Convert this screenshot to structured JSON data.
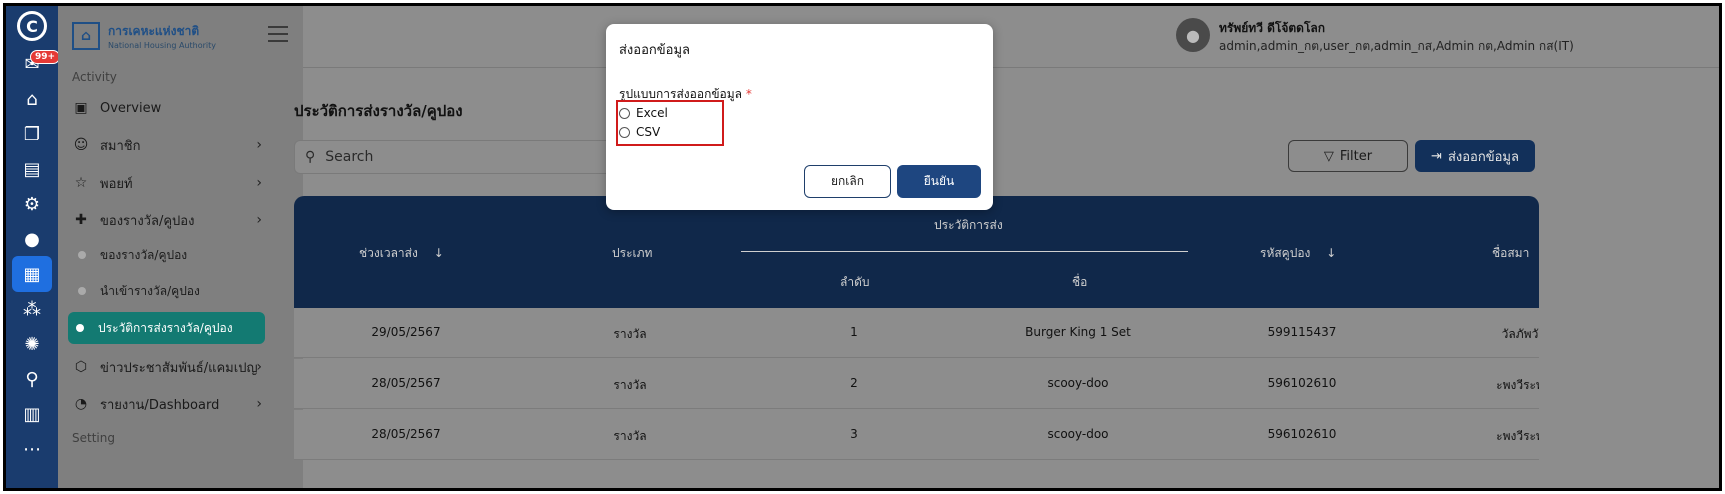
{
  "rail": {
    "badge_count": "99+",
    "icons": [
      "logo-icon",
      "inbox-icon",
      "home-icon",
      "copy-icon",
      "document-icon",
      "settings-gear-icon",
      "user-icon",
      "dashboard-grid-icon",
      "group-icon",
      "settings-cog-icon",
      "search-icon",
      "bar-chart-icon",
      "more-icon"
    ]
  },
  "brand": {
    "name_th": "การเคหะแห่งชาติ",
    "name_en": "National Housing Authority"
  },
  "sidebar": {
    "section_activity": "Activity",
    "section_setting": "Setting",
    "items": {
      "overview": "Overview",
      "member": "สมาชิก",
      "point": "พอยท์",
      "reward": "ของรางวัล/คูปอง",
      "reward_sub": "ของรางวัล/คูปอง",
      "import_sub": "นำเข้ารางวัล/คูปอง",
      "history_sub": "ประวัติการส่งรางวัล/คูปอง",
      "news": "ข่าวประชาสัมพันธ์/แคมเปญ",
      "report": "รายงาน/Dashboard"
    }
  },
  "user": {
    "name": "ทรัพย์ทวี ดีโจ้ตดโลก",
    "roles": "admin,admin_กต,user_กต,admin_กส,Admin กต,Admin กส(IT)"
  },
  "page": {
    "title": "ประวัติการส่งรางวัล/คูปอง",
    "search_placeholder": "Search",
    "filter_label": "Filter",
    "export_label": "ส่งออกข้อมูล"
  },
  "table": {
    "headers": {
      "period": "ช่วงเวลาส่ง",
      "type": "ประเภท",
      "history_group": "ประวัติการส่ง",
      "order": "ลำดับ",
      "name": "ชื่อ",
      "coupon_code": "รหัสคูปอง",
      "member_name": "ชื่อสมา"
    },
    "rows": [
      {
        "period": "29/05/2567",
        "type": "รางวัล",
        "order": "1",
        "name": "Burger King 1 Set",
        "code": "599115437",
        "member": "วัลภัพวั"
      },
      {
        "period": "28/05/2567",
        "type": "รางวัล",
        "order": "2",
        "name": "scooy-doo",
        "code": "596102610",
        "member": "ะพงวีระพ"
      },
      {
        "period": "28/05/2567",
        "type": "รางวัล",
        "order": "3",
        "name": "scooy-doo",
        "code": "596102610",
        "member": "ะพงวีระพ"
      }
    ]
  },
  "dialog": {
    "title": "ส่งออกข้อมูล",
    "field_label": "รูปแบบการส่งออกข้อมูล",
    "required_mark": "*",
    "options": [
      "Excel",
      "CSV"
    ],
    "cancel_label": "ยกเลิก",
    "confirm_label": "ยืนยัน"
  }
}
